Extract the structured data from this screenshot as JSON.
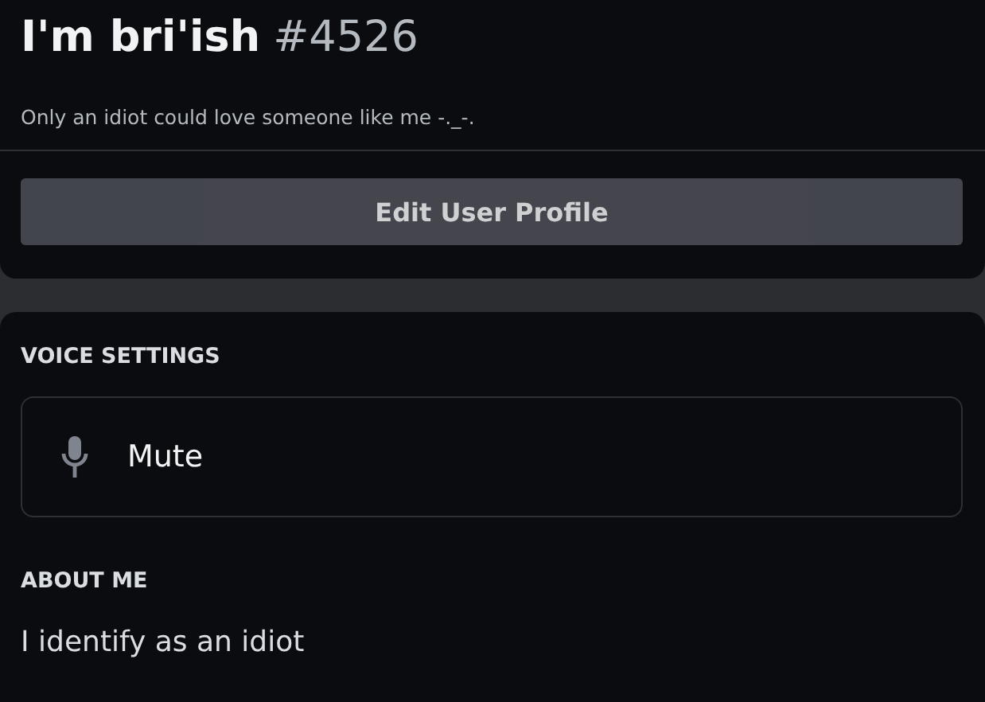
{
  "profile": {
    "display_name": "I'm bri'ish",
    "tag": "#4526",
    "status": "Only an idiot could love someone like me -._-."
  },
  "edit_button": "Edit User Profile",
  "voice_settings": {
    "heading": "VOICE SETTINGS",
    "mute_button": "Mute"
  },
  "about_me": {
    "heading": "ABOUT ME",
    "text": "I identify as an idiot"
  }
}
